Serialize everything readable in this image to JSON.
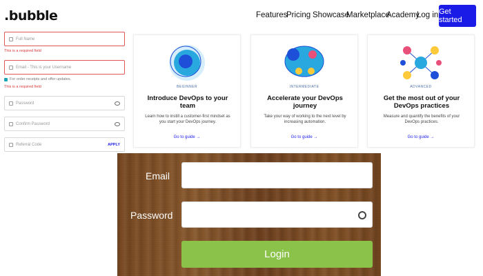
{
  "header": {
    "logo": ".bubble",
    "nav": [
      "Features",
      "Pricing",
      "Showcase",
      "Marketplace",
      "Academy",
      "Log in"
    ],
    "cta": "Get started"
  },
  "form": {
    "full_name_placeholder": "Full Name",
    "full_name_error": "This is a required field",
    "email_placeholder": "Email - This is your Username",
    "email_error": "This is a required field",
    "offers_text": "For order receipts and offer updates.",
    "password_placeholder": "Password",
    "confirm_password_placeholder": "Confirm Password",
    "referral_placeholder": "Referral Code",
    "apply_label": "APPLY"
  },
  "cards": [
    {
      "level": "BEGINNER",
      "title": "Introduce DevOps to your team",
      "desc": "Learn how to instill a customer-first mindset as you start your DevOps journey.",
      "link": "Go to guide →"
    },
    {
      "level": "INTERMEDIATE",
      "title": "Accelerate your DevOps journey",
      "desc": "Take your way of working to the next level by increasing automation.",
      "link": "Go to guide →"
    },
    {
      "level": "ADVANCED",
      "title": "Get the most out of your DevOps practices",
      "desc": "Measure and quantify the benefits of your DevOps practices.",
      "link": "Go to guide →"
    }
  ],
  "login": {
    "email_label": "Email",
    "password_label": "Password",
    "button": "Login"
  },
  "colors": {
    "brand": "#1b1be8",
    "error": "#d83a3a",
    "login_button": "#8bc34a"
  }
}
